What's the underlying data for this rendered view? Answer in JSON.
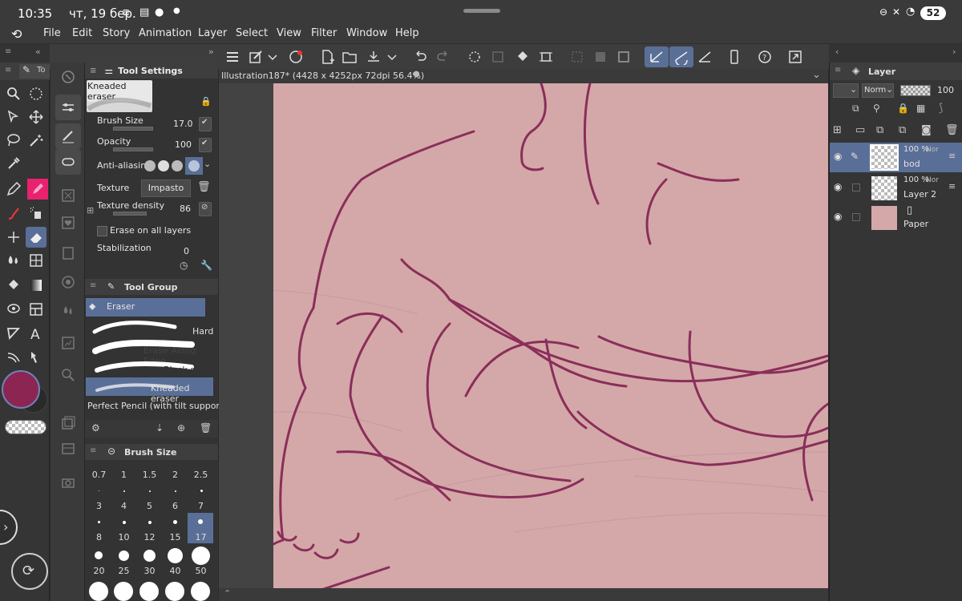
{
  "status": {
    "time": "10:35",
    "date": "чт, 19 бер.",
    "battery": "52"
  },
  "menu": [
    "File",
    "Edit",
    "Story",
    "Animation",
    "Layer",
    "Select",
    "View",
    "Filter",
    "Window",
    "Help"
  ],
  "tool_settings": {
    "title": "Tool Settings",
    "brush_name": "Kneaded eraser",
    "brush_size_label": "Brush Size",
    "brush_size_value": "17.0",
    "opacity_label": "Opacity",
    "opacity_value": "100",
    "antialiasing_label": "Anti-aliasing",
    "texture_label": "Texture",
    "impasto_label": "Impasto",
    "texture_density_label": "Texture density",
    "texture_density_value": "86",
    "erase_all_label": "Erase on all layers",
    "stabilization_label": "Stabilization",
    "stabilization_value": "0"
  },
  "tool_group": {
    "title": "Tool Group",
    "group_name": "Eraser",
    "items": [
      {
        "label": "Hard"
      },
      {
        "label": "Erase Along Edge"
      },
      {
        "label": "Black soot 2"
      },
      {
        "label": "Kneaded eraser"
      },
      {
        "label": "Perfect Pencil (with tilt support)"
      }
    ]
  },
  "brush_size_panel": {
    "title": "Brush Size",
    "sizes": [
      "0.7",
      "1",
      "1.5",
      "2",
      "2.5",
      "3",
      "4",
      "5",
      "6",
      "7",
      "8",
      "10",
      "12",
      "15",
      "17",
      "20",
      "25",
      "30",
      "40",
      "50"
    ],
    "selected": "17"
  },
  "canvas": {
    "tab_title": "Illustration187* (4428 x 4252px 72dpi 56.4%)",
    "bg_color": "#d4a8a8",
    "line_color": "#8a2e5a"
  },
  "layer_panel": {
    "title": "Layer",
    "blend_mode": "Norm",
    "opacity": "100",
    "layers": [
      {
        "opacity": "100 %",
        "mode": "Nor",
        "name": "bod"
      },
      {
        "opacity": "100 %",
        "mode": "Nor",
        "name": "Layer 2"
      },
      {
        "opacity": "",
        "mode": "",
        "name": "Paper"
      }
    ]
  },
  "colors": {
    "main": "#8c2552",
    "accent": "#5a6f97",
    "sub_color_selected": "#e8226e"
  }
}
